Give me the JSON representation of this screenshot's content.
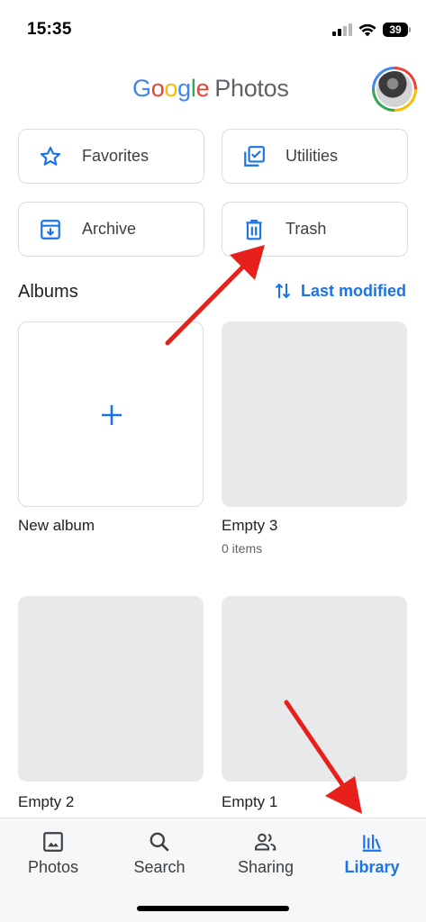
{
  "status_bar": {
    "time": "15:35",
    "battery": "39"
  },
  "header": {
    "logo": [
      {
        "ch": "G",
        "color": "#4285f4"
      },
      {
        "ch": "o",
        "color": "#ea4335"
      },
      {
        "ch": "o",
        "color": "#fbbc05"
      },
      {
        "ch": "g",
        "color": "#4285f4"
      },
      {
        "ch": "l",
        "color": "#34a853"
      },
      {
        "ch": "e",
        "color": "#ea4335"
      }
    ],
    "logo_suffix": "Photos"
  },
  "quick_actions": {
    "favorites": "Favorites",
    "utilities": "Utilities",
    "archive": "Archive",
    "trash": "Trash"
  },
  "albums": {
    "title": "Albums",
    "sort_label": "Last modified",
    "items": [
      {
        "title": "New album",
        "subtitle": ""
      },
      {
        "title": "Empty 3",
        "subtitle": "0 items"
      },
      {
        "title": "Empty 2",
        "subtitle": ""
      },
      {
        "title": "Empty 1",
        "subtitle": ""
      }
    ]
  },
  "bottom_nav": {
    "items": [
      {
        "label": "Photos",
        "icon": "photo-icon"
      },
      {
        "label": "Search",
        "icon": "search-icon"
      },
      {
        "label": "Sharing",
        "icon": "people-icon"
      },
      {
        "label": "Library",
        "icon": "library-icon",
        "active": true
      }
    ]
  },
  "colors": {
    "accent": "#1a73e8",
    "annotation_arrow": "#e8201c"
  }
}
